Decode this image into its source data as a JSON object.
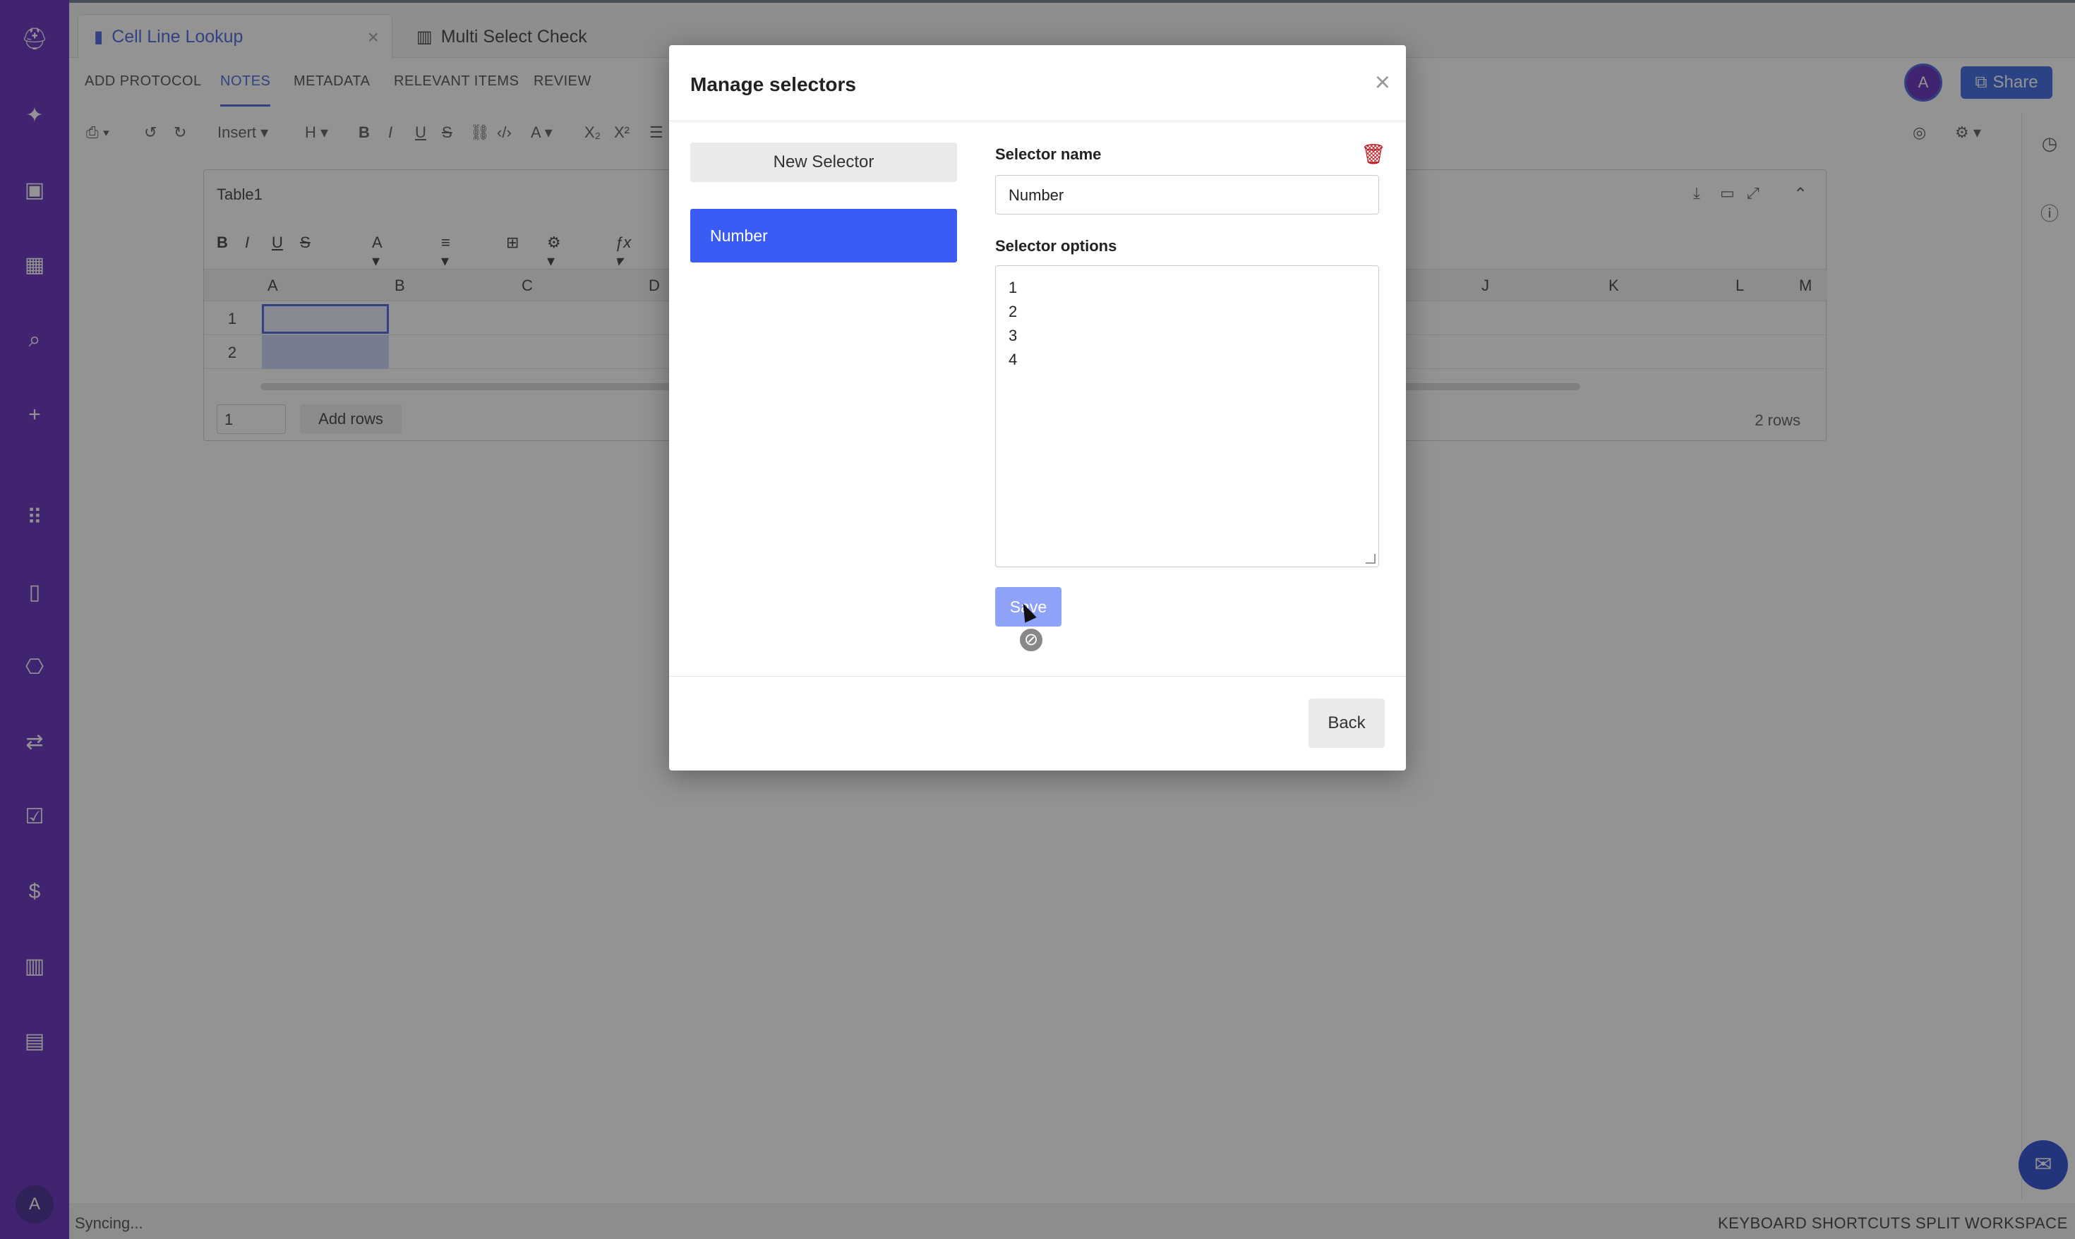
{
  "sidebar": {
    "icons": [
      {
        "name": "logo-icon",
        "glyph": "⛑"
      },
      {
        "name": "sparkle-icon",
        "glyph": "✦"
      },
      {
        "name": "briefcase-icon",
        "glyph": "💼"
      },
      {
        "name": "book-icon",
        "glyph": "📖"
      },
      {
        "name": "search-icon",
        "glyph": "⌕"
      },
      {
        "name": "plus-icon",
        "glyph": "+"
      },
      {
        "name": "apps-grid-icon",
        "glyph": "⠿"
      },
      {
        "name": "beaker-icon",
        "glyph": "▯"
      },
      {
        "name": "hierarchy-icon",
        "glyph": "⎔"
      },
      {
        "name": "workflow-icon",
        "glyph": "⇄"
      },
      {
        "name": "clipboard-check-icon",
        "glyph": "📋"
      },
      {
        "name": "dollar-box-icon",
        "glyph": "$"
      },
      {
        "name": "chart-icon",
        "glyph": "▥"
      },
      {
        "name": "folder-icon",
        "glyph": "▤"
      }
    ],
    "avatar_initial": "A"
  },
  "tabs": [
    {
      "label": "Cell Line Lookup",
      "icon": "document-icon",
      "active": true
    },
    {
      "label": "Multi Select Check",
      "icon": "chart-icon",
      "active": false
    }
  ],
  "subnav": [
    "ADD PROTOCOL",
    "NOTES",
    "METADATA",
    "RELEVANT ITEMS",
    "REVIEW"
  ],
  "subnav_active": "NOTES",
  "header": {
    "avatar_initial": "A",
    "share_label": "Share"
  },
  "toolbar": {
    "insert_label": "Insert",
    "heading_label": "H"
  },
  "table": {
    "title": "Table1",
    "columns": [
      "A",
      "B",
      "C",
      "D",
      "J",
      "K",
      "L",
      "M"
    ],
    "rows": [
      "1",
      "2"
    ],
    "rows_input_value": "1",
    "add_rows_label": "Add rows",
    "rows_count": "2 rows"
  },
  "status": {
    "text": "Syncing...",
    "keyboard_shortcuts": "KEYBOARD SHORTCUTS",
    "split_workspace": "SPLIT WORKSPACE"
  },
  "modal": {
    "title": "Manage selectors",
    "new_selector_label": "New Selector",
    "selectors": [
      "Number"
    ],
    "selector_name_label": "Selector name",
    "selector_name_value": "Number",
    "selector_options_label": "Selector options",
    "options": [
      "1",
      "2",
      "3",
      "4"
    ],
    "save_label": "Save",
    "back_label": "Back"
  },
  "colors": {
    "sidebar": "#5b21b6",
    "accent": "#3b5bf5",
    "save_disabled": "#8ea3f8",
    "delete": "#c0141c"
  }
}
